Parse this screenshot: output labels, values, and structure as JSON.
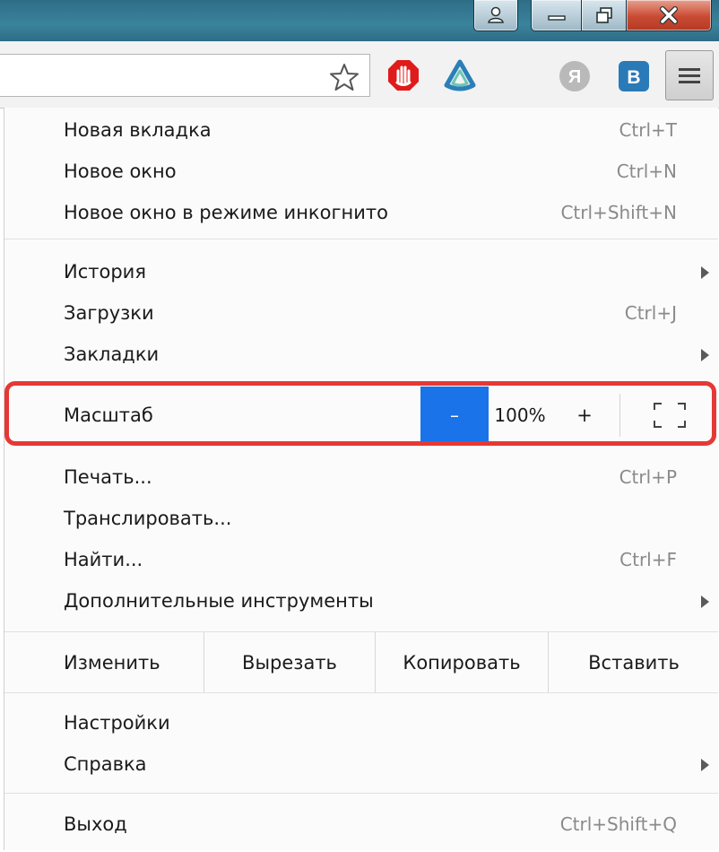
{
  "window": {
    "buttons": [
      "user-icon",
      "minimize-icon",
      "restore-icon",
      "close-icon"
    ]
  },
  "toolbar": {
    "extensions": [
      {
        "name": "bookmark-star-icon"
      },
      {
        "name": "adblock-icon",
        "color": "#e01b1b"
      },
      {
        "name": "extension-icon",
        "color": "#2b7fb8"
      },
      {
        "name": "yandex-icon",
        "label": "Я"
      },
      {
        "name": "vk-icon",
        "label": "B",
        "color": "#2a7ab8"
      }
    ],
    "menu_icon": "hamburger-icon"
  },
  "menu": {
    "group1": [
      {
        "label": "Новая вкладка",
        "shortcut": "Ctrl+T"
      },
      {
        "label": "Новое окно",
        "shortcut": "Ctrl+N"
      },
      {
        "label": "Новое окно в режиме инкогнито",
        "shortcut": "Ctrl+Shift+N"
      }
    ],
    "group2": [
      {
        "label": "История",
        "submenu": true
      },
      {
        "label": "Загрузки",
        "shortcut": "Ctrl+J"
      },
      {
        "label": "Закладки",
        "submenu": true
      }
    ],
    "zoom": {
      "label": "Масштаб",
      "minus": "–",
      "value": "100%",
      "plus": "+",
      "fullscreen_icon": "fullscreen-icon",
      "highlight_color": "#e53935"
    },
    "group3": [
      {
        "label": "Печать...",
        "shortcut": "Ctrl+P"
      },
      {
        "label": "Транслировать..."
      },
      {
        "label": "Найти...",
        "shortcut": "Ctrl+F"
      },
      {
        "label": "Дополнительные инструменты",
        "submenu": true
      }
    ],
    "edit": {
      "label": "Изменить",
      "cut": "Вырезать",
      "copy": "Копировать",
      "paste": "Вставить"
    },
    "group4": [
      {
        "label": "Настройки"
      },
      {
        "label": "Справка",
        "submenu": true
      }
    ],
    "group5": [
      {
        "label": "Выход",
        "shortcut": "Ctrl+Shift+Q"
      }
    ]
  },
  "colors": {
    "accent": "#1a73e8",
    "titlebar": "#3b839c"
  }
}
